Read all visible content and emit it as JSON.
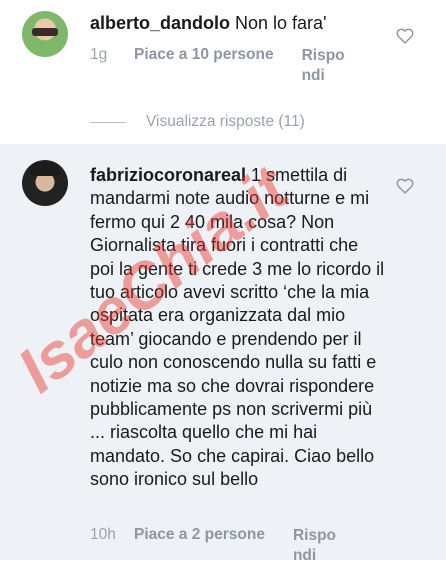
{
  "comments": [
    {
      "username": "alberto_dandolo",
      "text": " Non lo fara'",
      "time": "1g",
      "likes": "Piace a 10 persone",
      "reply": "Rispondi",
      "view_replies": "Visualizza risposte (11)"
    },
    {
      "username": "fabriziocoronareal",
      "text": " 1 smettila di mandarmi note audio notturne e mi fermo qui 2 40 mila cosa? Non Giornalista tira fuori i contratti che poi la gente ti crede 3 me lo ricordo il tuo articolo avevi scritto ‘che la mia ospitata era organizzata dal mio team’ giocando e prendendo per il culo non conoscendo nulla su fatti e notizie ma so che dovrai rispondere pubblicamente ps non scrivermi più ... riascolta quello che mi hai mandato. So che capirai. Ciao bello sono ironico sul bello",
      "time": "10h",
      "likes": "Piace a 2 persone",
      "reply": "Rispondi"
    }
  ],
  "watermark": "IsaeChia.it",
  "colors": {
    "highlight_bg": "#eef2f6",
    "meta_text": "#9aa3ad",
    "watermark": "#e8342a"
  },
  "icons": {
    "like": "heart-outline-icon"
  }
}
